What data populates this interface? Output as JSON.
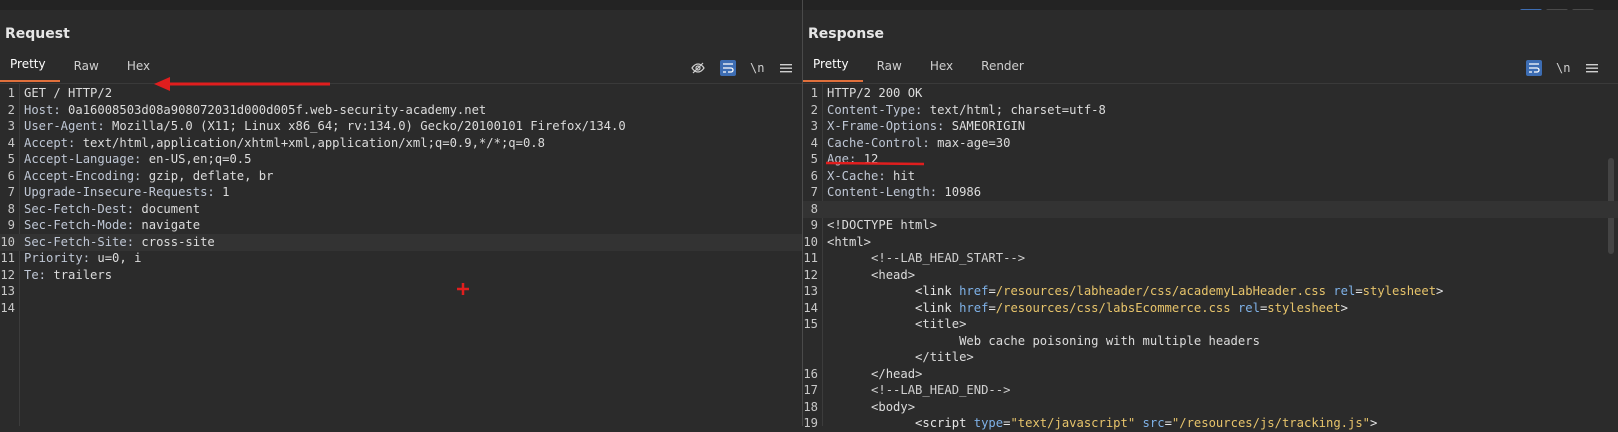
{
  "request": {
    "title": "Request",
    "tabs": [
      "Pretty",
      "Raw",
      "Hex"
    ],
    "tools": [
      "eye-off-icon",
      "wrap-icon",
      "\\n",
      "menu-icon"
    ],
    "lines": [
      {
        "n": "1",
        "text": "GET / HTTP/2"
      },
      {
        "n": "2",
        "key": "Host:",
        "val": " 0a16008503d08a908072031d000d005f.web-security-academy.net"
      },
      {
        "n": "3",
        "key": "User-Agent:",
        "val": " Mozilla/5.0 (X11; Linux x86_64; rv:134.0) Gecko/20100101 Firefox/134.0"
      },
      {
        "n": "4",
        "key": "Accept:",
        "val": " text/html,application/xhtml+xml,application/xml;q=0.9,*/*;q=0.8"
      },
      {
        "n": "5",
        "key": "Accept-Language:",
        "val": " en-US,en;q=0.5"
      },
      {
        "n": "6",
        "key": "Accept-Encoding:",
        "val": " gzip, deflate, br"
      },
      {
        "n": "7",
        "key": "Upgrade-Insecure-Requests:",
        "val": " 1"
      },
      {
        "n": "8",
        "key": "Sec-Fetch-Dest:",
        "val": " document"
      },
      {
        "n": "9",
        "key": "Sec-Fetch-Mode:",
        "val": " navigate"
      },
      {
        "n": "10",
        "key": "Sec-Fetch-Site:",
        "val": " cross-site"
      },
      {
        "n": "11",
        "key": "Priority:",
        "val": " u=0, i"
      },
      {
        "n": "12",
        "key": "Te:",
        "val": " trailers"
      },
      {
        "n": "13",
        "text": ""
      },
      {
        "n": "14",
        "text": ""
      }
    ]
  },
  "response": {
    "title": "Response",
    "tabs": [
      "Pretty",
      "Raw",
      "Hex",
      "Render"
    ],
    "tools": [
      "wrap-icon",
      "\\n",
      "menu-icon"
    ],
    "lines": [
      {
        "n": "1",
        "text": "HTTP/2 200 OK"
      },
      {
        "n": "2",
        "key": "Content-Type:",
        "val": " text/html; charset=utf-8"
      },
      {
        "n": "3",
        "key": "X-Frame-Options:",
        "val": " SAMEORIGIN"
      },
      {
        "n": "4",
        "key": "Cache-Control:",
        "val": " max-age=30"
      },
      {
        "n": "5",
        "key": "Age:",
        "val": " 12"
      },
      {
        "n": "6",
        "key": "X-Cache:",
        "val": " hit"
      },
      {
        "n": "7",
        "key": "Content-Length:",
        "val": " 10986"
      },
      {
        "n": "8",
        "text": ""
      },
      {
        "n": "9",
        "text": "<!DOCTYPE html>"
      },
      {
        "n": "10",
        "text": "<html>"
      },
      {
        "n": "11",
        "text": "      <!--LAB_HEAD_START-->"
      },
      {
        "n": "12",
        "text": "      <head>"
      },
      {
        "n": "13",
        "html_parts": [
          "            <link ",
          "href",
          "=",
          "/resources/labheader/css/academyLabHeader.css",
          " ",
          "rel",
          "=",
          "stylesheet",
          ">"
        ]
      },
      {
        "n": "14",
        "html_parts": [
          "            <link ",
          "href",
          "=",
          "/resources/css/labsEcommerce.css",
          " ",
          "rel",
          "=",
          "stylesheet",
          ">"
        ]
      },
      {
        "n": "15",
        "text": "            <title>"
      },
      {
        "n": "",
        "text": "                  Web cache poisoning with multiple headers"
      },
      {
        "n": "",
        "text": "            </title>"
      },
      {
        "n": "16",
        "text": "      </head>"
      },
      {
        "n": "17",
        "text": "      <!--LAB_HEAD_END-->"
      },
      {
        "n": "18",
        "text": "      <body>"
      },
      {
        "n": "19",
        "html_parts": [
          "            <script ",
          "type",
          "=",
          "\"text/javascript\"",
          " ",
          "src",
          "=",
          "\"/resources/js/tracking.js\"",
          ">"
        ]
      }
    ]
  },
  "colors": {
    "accent": "#e0703c",
    "active_button": "#3d6db3",
    "annotation": "#e01e1e"
  }
}
